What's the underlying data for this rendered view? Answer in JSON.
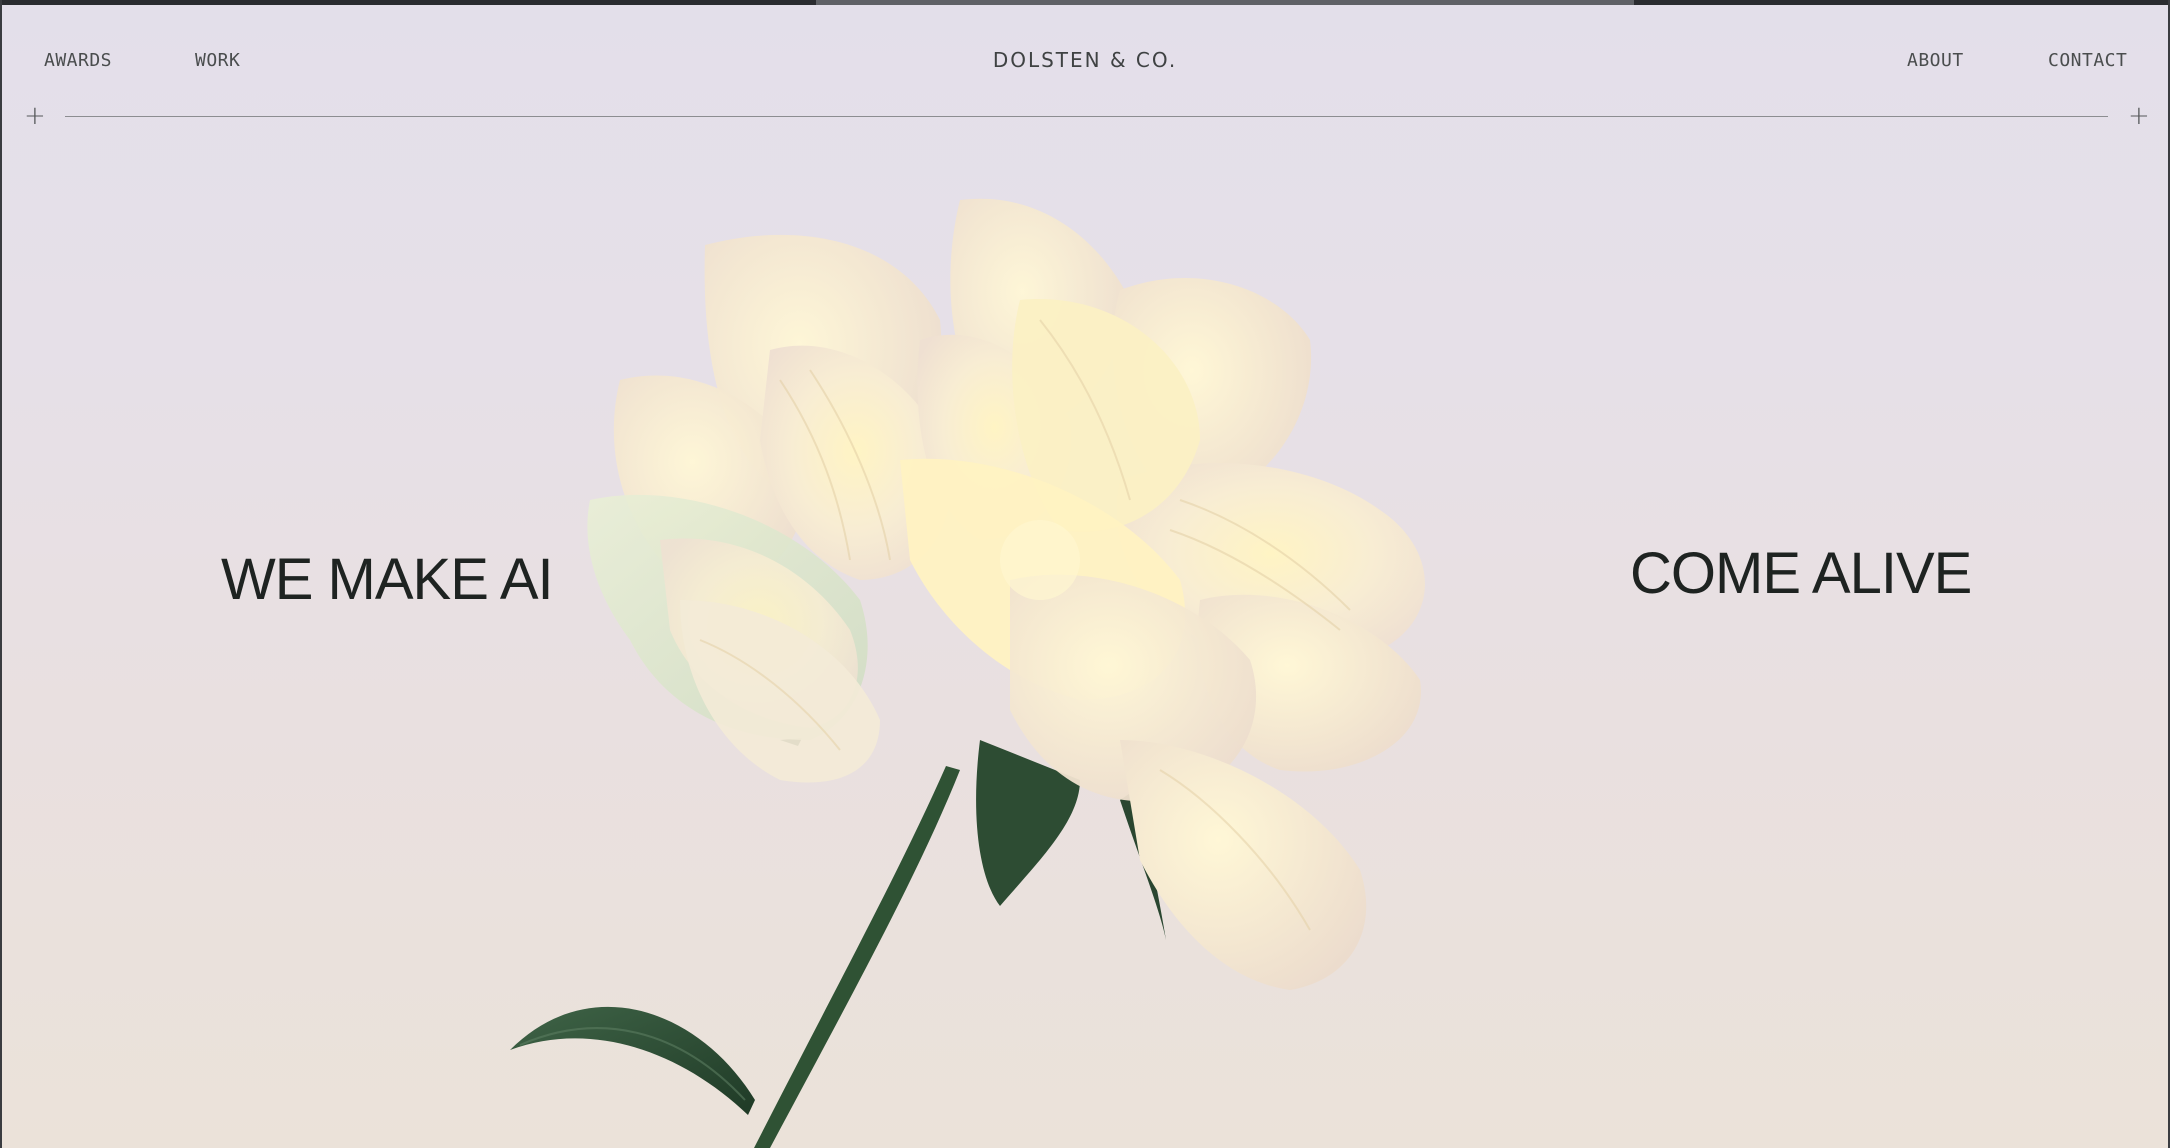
{
  "nav": {
    "left": [
      {
        "label": "AWARDS"
      },
      {
        "label": "WORK"
      }
    ],
    "brand": "DOLSTEN & CO.",
    "right": [
      {
        "label": "ABOUT"
      },
      {
        "label": "CONTACT"
      }
    ]
  },
  "hero": {
    "left_text": "WE MAKE AI",
    "right_text": "COME ALIVE",
    "image": "flower-illustration"
  },
  "decor": {
    "plus_left": "+",
    "plus_right": "+"
  },
  "colors": {
    "background_top": "#e3dfea",
    "background_bottom": "#ebe2d9",
    "text": "#1f2322",
    "petal": "#f7efcf",
    "stem": "#2e4a32"
  }
}
